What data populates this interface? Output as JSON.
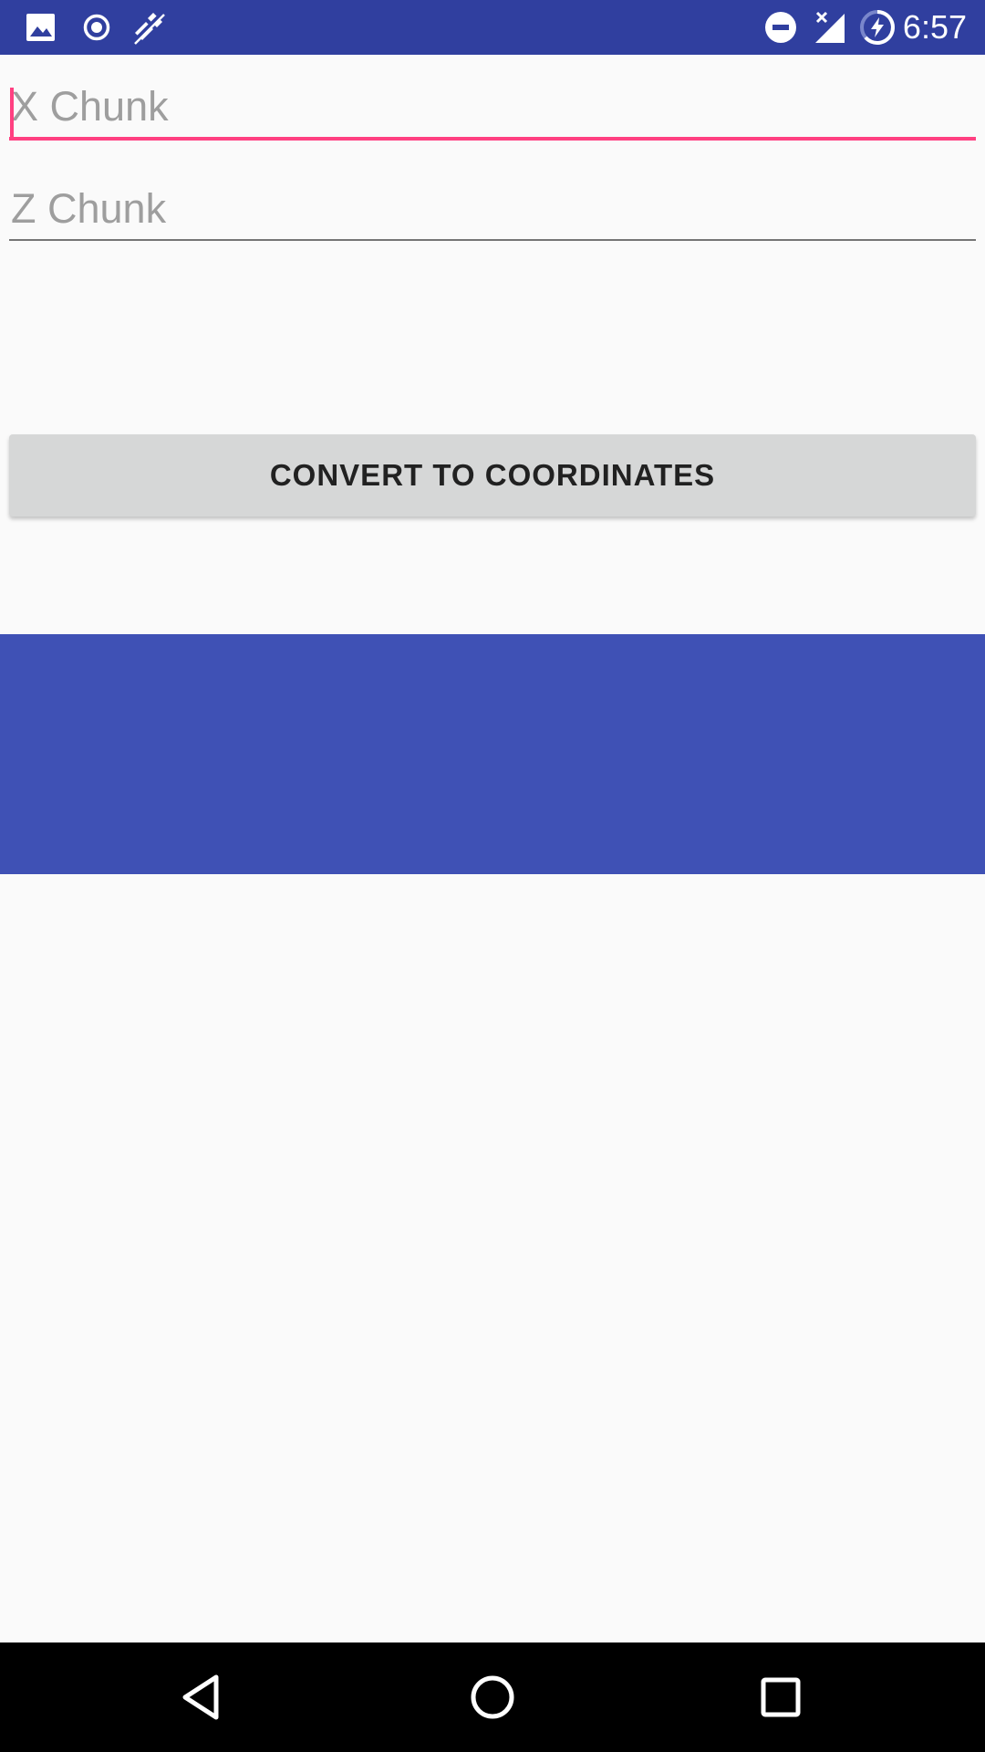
{
  "status_bar": {
    "time": "6:57",
    "background": "#303f9f",
    "left_icons": [
      "image-icon",
      "record-icon",
      "no-signal-satellite-icon"
    ],
    "right_icons": [
      "do-not-disturb-icon",
      "no-cell-signal-icon",
      "battery-charging-icon"
    ]
  },
  "form": {
    "x_chunk": {
      "placeholder": "X Chunk",
      "value": "",
      "focused": true
    },
    "z_chunk": {
      "placeholder": "Z Chunk",
      "value": "",
      "focused": false
    },
    "accent_color": "#ff4081",
    "underline_color": "#757575"
  },
  "convert_button": {
    "label": "CONVERT TO COORDINATES"
  },
  "banner": {
    "color": "#3f51b5"
  },
  "nav_bar": {
    "icons": [
      "back-icon",
      "home-icon",
      "recents-icon"
    ]
  }
}
